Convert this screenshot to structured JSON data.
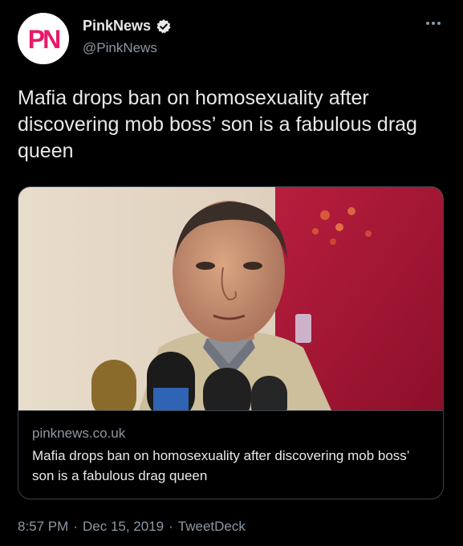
{
  "author": {
    "display_name": "PinkNews",
    "handle": "@PinkNews",
    "avatar_text": "PN",
    "verified": true
  },
  "tweet": {
    "text": "Mafia drops ban on homosexuality after discovering mob boss’ son is a fabulous drag queen"
  },
  "card": {
    "domain": "pinknews.co.uk",
    "title": "Mafia drops ban on homosexuality after discovering mob boss’ son is a fabulous drag queen"
  },
  "meta": {
    "time": "8:57 PM",
    "separator1": "·",
    "date": "Dec 15, 2019",
    "separator2": "·",
    "source": "TweetDeck"
  },
  "icons": {
    "verified": "verified-badge-icon",
    "more": "more-options-icon"
  },
  "colors": {
    "background": "#000000",
    "text": "#e7e9ea",
    "secondary": "#8b98a5",
    "brand_pink": "#e8196a"
  }
}
